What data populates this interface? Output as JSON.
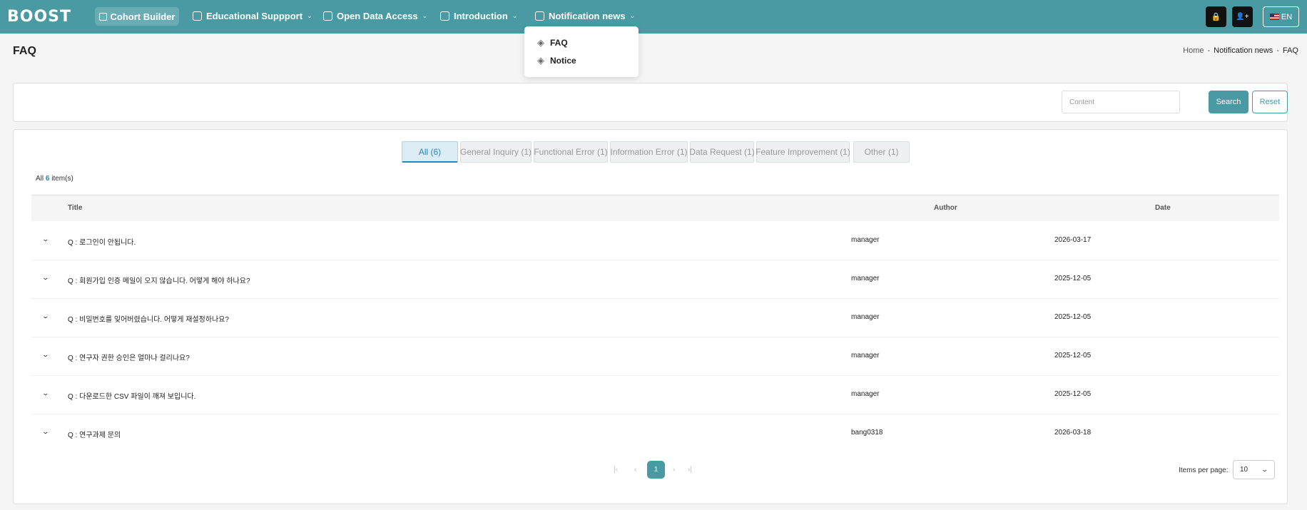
{
  "nav": {
    "logo": "BOOST",
    "cohort_builder": "Cohort Builder",
    "items": [
      {
        "label": "Educational Suppport",
        "icon": "document-icon"
      },
      {
        "label": "Open Data Access",
        "icon": "document-icon"
      },
      {
        "label": "Introduction",
        "icon": "chart-icon"
      },
      {
        "label": "Notification news",
        "icon": "chart-icon"
      }
    ],
    "lock_icon": "🔒",
    "user_add_icon": "👤+",
    "language": "EN"
  },
  "dropdown": {
    "items": [
      {
        "label": "FAQ",
        "icon": "layers-icon"
      },
      {
        "label": "Notice",
        "icon": "layers-icon"
      }
    ]
  },
  "page": {
    "title": "FAQ",
    "breadcrumb": [
      "Home",
      "-",
      "Notification news",
      "-",
      "FAQ"
    ]
  },
  "search": {
    "placeholder": "Content",
    "search_label": "Search",
    "reset_label": "Reset"
  },
  "tabs": [
    {
      "label": "All (6)",
      "active": true
    },
    {
      "label": "General Inquiry (1)",
      "active": false
    },
    {
      "label": "Functional Error (1)",
      "active": false
    },
    {
      "label": "Information Error (1)",
      "active": false
    },
    {
      "label": "Data Request (1)",
      "active": false
    },
    {
      "label": "Feature Improvement (1)",
      "active": false
    },
    {
      "label": "Other (1)",
      "active": false
    }
  ],
  "count": {
    "prefix": "All",
    "num": "6",
    "suffix": "item(s)"
  },
  "table": {
    "headers": [
      "Title",
      "Author",
      "Date"
    ],
    "rows": [
      {
        "title": "Q : 로그인이 안됩니다.",
        "author": "manager",
        "date": "2026-03-17"
      },
      {
        "title": "Q : 회원가입 인증 메일이 오지 않습니다. 어떻게 해야 하나요?",
        "author": "manager",
        "date": "2025-12-05"
      },
      {
        "title": "Q : 비밀번호를 잊어버렸습니다. 어떻게 재설정하나요?",
        "author": "manager",
        "date": "2025-12-05"
      },
      {
        "title": "Q : 연구자 권한 승인은 얼마나 걸리나요?",
        "author": "manager",
        "date": "2025-12-05"
      },
      {
        "title": "Q : 다운로드한 CSV 파일이 깨져 보입니다.",
        "author": "manager",
        "date": "2025-12-05"
      },
      {
        "title": "Q : 연구과제 문의",
        "author": "bang0318",
        "date": "2026-03-18"
      }
    ]
  },
  "pagination": {
    "first": "|‹",
    "prev": "‹",
    "current": "1",
    "next": "›",
    "last": "›|",
    "items_per_page_label": "Items per page:",
    "items_per_page_value": "10"
  },
  "colors": {
    "accent": "#4a9aa4",
    "link": "#2d84b5"
  }
}
